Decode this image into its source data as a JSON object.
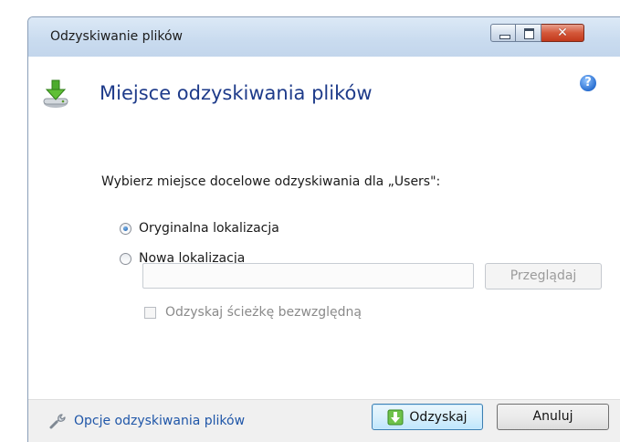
{
  "window": {
    "title": "Odzyskiwanie plików",
    "close_glyph": "✕"
  },
  "header": {
    "title": "Miejsce odzyskiwania plików",
    "icon": "download-drive-icon",
    "help_icon": "help-icon",
    "help_glyph": "?"
  },
  "main": {
    "prompt": "Wybierz miejsce docelowe odzyskiwania dla „Users\":",
    "options": [
      {
        "label": "Oryginalna lokalizacja",
        "checked": true
      },
      {
        "label": "Nowa lokalizacja",
        "checked": false
      }
    ],
    "path_input": {
      "value": "",
      "placeholder": ""
    },
    "browse_label": "Przeglądaj",
    "absolute_path_label": "Odzyskaj ścieżkę bezwzględną",
    "absolute_path_checked": false
  },
  "footer": {
    "options_link": "Opcje odzyskiwania plików",
    "recover_label": "Odzyskaj",
    "cancel_label": "Anuluj"
  },
  "colors": {
    "title_accent": "#1e3b8a",
    "link": "#1f56a8",
    "disabled_text": "#8a8a8a"
  }
}
